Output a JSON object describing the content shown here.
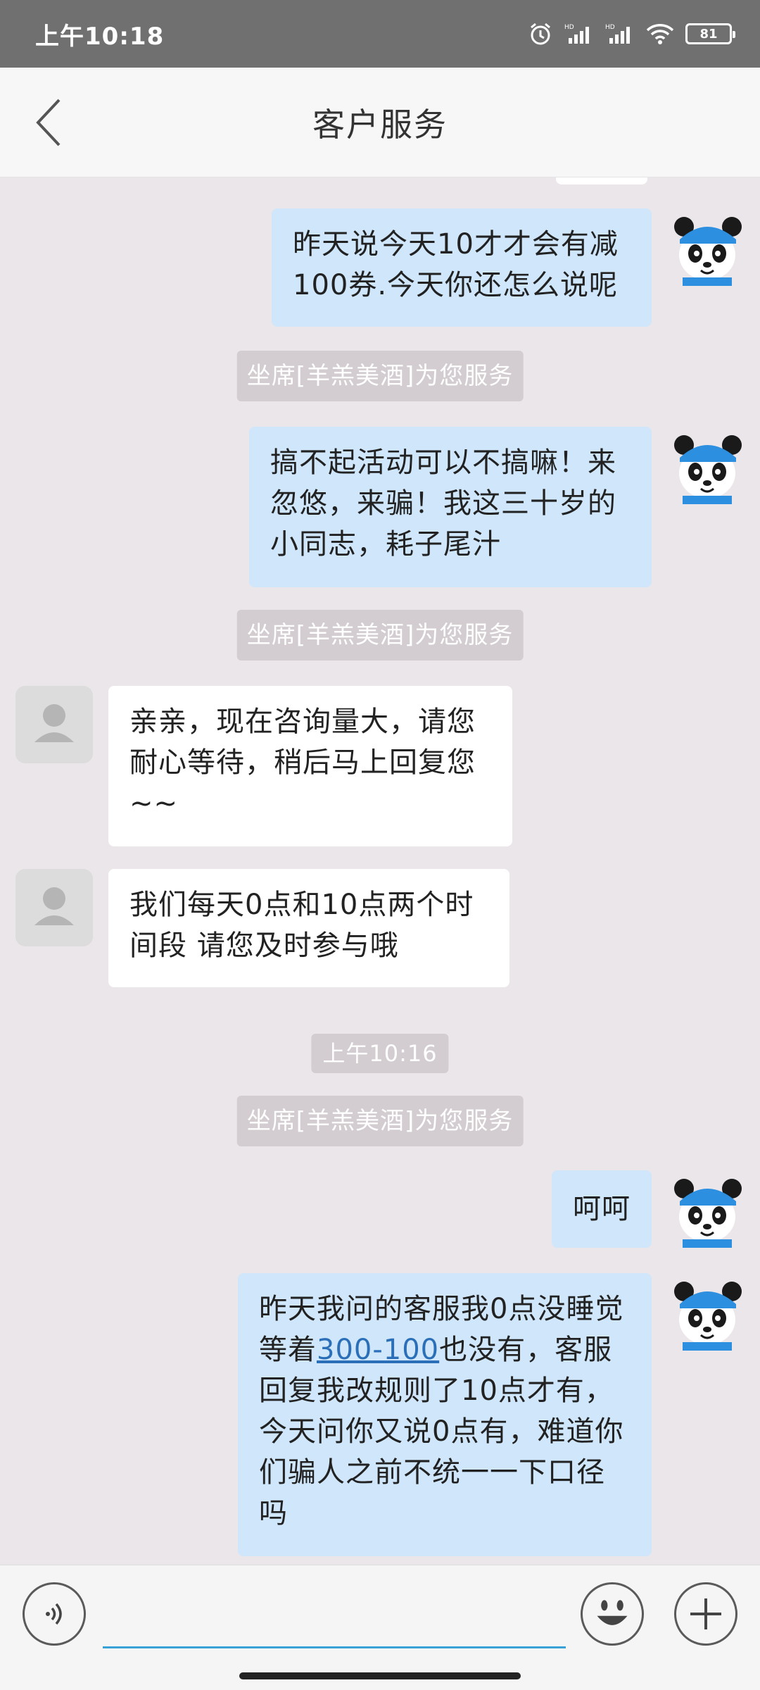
{
  "status_bar": {
    "time": "上午10:18",
    "battery": "81"
  },
  "header": {
    "title": "客户服务"
  },
  "messages": {
    "m1": "昨天说今天10才才会有减100券.今天你还怎么说呢",
    "sys1": "坐席[羊羔美酒]为您服务",
    "m2": "搞不起活动可以不搞嘛！来忽悠，来骗！我这三十岁的小同志，耗子尾汁",
    "sys2": "坐席[羊羔美酒]为您服务",
    "r1": "亲亲，现在咨询量大，请您耐心等待，稍后马上回复您~~",
    "r2": "我们每天0点和10点两个时间段 请您及时参与哦",
    "time1": "上午10:16",
    "sys3": "坐席[羊羔美酒]为您服务",
    "m3": "呵呵",
    "m4_before": "昨天我问的客服我0点没睡觉等着",
    "m4_link": "300-100",
    "m4_after": "也没有，客服回复我改规则了10点才有，今天问你又说0点有，难道你们骗人之前不统一一下口径吗"
  },
  "input": {
    "placeholder": ""
  },
  "colors": {
    "my_bubble": "#cfe6fb",
    "their_bubble": "#ffffff",
    "background": "#ebe6ea",
    "input_underline": "#3aa1d6"
  },
  "icons": {
    "back": "chevron-left-icon",
    "voice": "voice-icon",
    "emoji": "smiley-icon",
    "plus": "plus-icon"
  }
}
